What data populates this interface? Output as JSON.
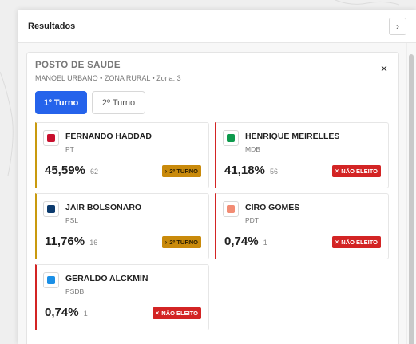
{
  "panel": {
    "title": "Resultados",
    "collapse_icon": "›"
  },
  "location": {
    "name": "POSTO DE SAUDE",
    "subtitle": "MANOEL URBANO • ZONA RURAL • Zona: 3",
    "close_icon": "×"
  },
  "tabs": [
    {
      "label": "1º Turno",
      "active": true
    },
    {
      "label": "2º Turno",
      "active": false
    }
  ],
  "candidates": [
    {
      "name": "FERNANDO HADDAD",
      "party": "PT",
      "color": "#c8102e",
      "percent": "45,59%",
      "votes": "62",
      "status": "2º TURNO",
      "status_icon": "›",
      "status_type": "turno"
    },
    {
      "name": "HENRIQUE MEIRELLES",
      "party": "MDB",
      "color": "#0e9a4d",
      "percent": "41,18%",
      "votes": "56",
      "status": "NÃO ELEITO",
      "status_icon": "×",
      "status_type": "nao"
    },
    {
      "name": "JAIR BOLSONARO",
      "party": "PSL",
      "color": "#0c3b6e",
      "percent": "11,76%",
      "votes": "16",
      "status": "2º TURNO",
      "status_icon": "›",
      "status_type": "turno"
    },
    {
      "name": "CIRO GOMES",
      "party": "PDT",
      "color": "#f28c74",
      "percent": "0,74%",
      "votes": "1",
      "status": "NÃO ELEITO",
      "status_icon": "×",
      "status_type": "nao"
    },
    {
      "name": "GERALDO ALCKMIN",
      "party": "PSDB",
      "color": "#1a8fe6",
      "percent": "0,74%",
      "votes": "1",
      "status": "NÃO ELEITO",
      "status_icon": "×",
      "status_type": "nao"
    }
  ]
}
